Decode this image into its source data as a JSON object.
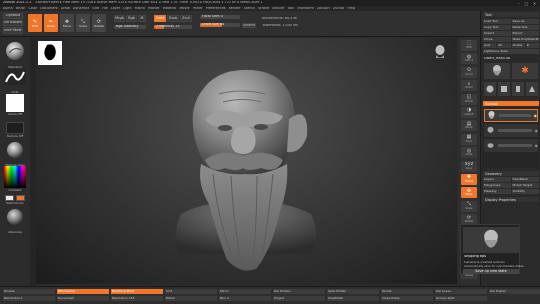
{
  "window": {
    "title": "ZBrush 2021.1.1",
    "subtitle": "ZBrushProject  ▸ Free Mem 19.7GB ▸ Active Mem 315 ▸ Scratch Disk 48 ▸ ZTime 1.31 Timer 0.003 ▸ PolyCount 1.721 KP ▸ MeshCount 1",
    "controls": [
      "–",
      "□",
      "✕"
    ]
  },
  "menubar": [
    "Alpha",
    "Brush",
    "Color",
    "Document",
    "Draw",
    "Dynamics",
    "Edit",
    "File",
    "Layer",
    "Light",
    "Macro",
    "Marker",
    "Material",
    "Movie",
    "Picker",
    "Preferences",
    "Render",
    "Stencil",
    "Stroke",
    "Texture",
    "Tool",
    "Transform",
    "Zplugin",
    "Zscript",
    "Help"
  ],
  "topshelf": {
    "lightbox": "LightBox",
    "live_boolean": "Live Boolean",
    "edit": "Edit",
    "draw": "Draw",
    "move": "Move",
    "scale": "Scale",
    "rotate": "Rotate",
    "mrgb": "Mrgb",
    "rgb": "Rgb",
    "m": "M",
    "zadd": "Zadd",
    "zsub": "Zsub",
    "zcut": "Zcut",
    "rgb_intensity": "Rgb Intensity",
    "z_intensity": "Z Intensity 25",
    "focal_shift": "Focal Shift 0",
    "draw_size": "Draw Size 64",
    "dynamic": "Dynamic",
    "active_points": "ActivePoints: 60,536",
    "total_points": "TotalPoints: 1.000 Mil",
    "quick_sketch": "Quick Sketch",
    "z_intensity_value": 0.25,
    "draw_size_value": 0.55
  },
  "leftshelf": [
    {
      "name": "brush",
      "label": "Standard"
    },
    {
      "name": "stroke",
      "label": "Dots"
    },
    {
      "name": "alpha",
      "label": "Alpha Off"
    },
    {
      "name": "texture",
      "label": "Texture Off"
    },
    {
      "name": "material",
      "label": "MatCap Gray"
    },
    {
      "name": "gradient",
      "label": "Gradient"
    },
    {
      "name": "switchcolor",
      "label": "SwitchColor"
    },
    {
      "name": "alternate",
      "label": "Alternate"
    }
  ],
  "rightstrip": [
    {
      "icon": "⬚",
      "label": "BPR"
    },
    {
      "icon": "◍",
      "label": "SPix 3"
    },
    {
      "icon": "⊙",
      "label": "Scroll"
    },
    {
      "icon": "⌕",
      "label": "Zoom"
    },
    {
      "icon": "◱",
      "label": "Actual"
    },
    {
      "icon": "◑",
      "label": "AAHalf"
    },
    {
      "icon": "▤",
      "label": "Persp"
    },
    {
      "icon": "▦",
      "label": "Floor"
    },
    {
      "icon": "◎",
      "label": "Local"
    },
    {
      "icon": "xyz",
      "label": "Gxyz"
    },
    {
      "icon": "✥",
      "label": "Frame"
    },
    {
      "icon": "✣",
      "label": "Move"
    },
    {
      "icon": "⤡",
      "label": "Scale"
    },
    {
      "icon": "⟳",
      "label": "Rotate"
    },
    {
      "icon": "▥",
      "label": "PolyF"
    },
    {
      "icon": "◫",
      "label": "Transp"
    },
    {
      "icon": "◨",
      "label": "Solo"
    },
    {
      "icon": "▣",
      "label": "Xpose"
    }
  ],
  "rightpanel": {
    "header": "Tool",
    "buttons": [
      [
        "Load Tool",
        "Save As"
      ],
      [
        "Copy Tool",
        "Paste Tool"
      ],
      [
        "Import",
        "Export"
      ],
      [
        "Clone",
        "Make PolyMesh3D"
      ],
      [
        "GoZ",
        "All",
        "Visible",
        "R"
      ],
      [
        "Lightbox ▸ Tools"
      ]
    ],
    "tool_name": "Dwarf_Head.48",
    "subtool": "Subtool",
    "geometry": "Geometry",
    "layers": "Layers",
    "fibermesh": "FiberMesh",
    "polygroups": "Polygroups",
    "morph_target": "Morph Target",
    "masking": "Masking",
    "visibility": "Visibility",
    "display_properties": "Display Properties"
  },
  "popup": {
    "title": "Shipping tips",
    "body": "Subsample smallest subtools",
    "body2": "Automatically save for intermediate states",
    "button": "Save up new state"
  },
  "bottombar": [
    "Double",
    "ZRemesher",
    "Backface Mask",
    "Smt",
    "Mirror",
    "Del Hidden",
    "Split Hidden",
    "Divide",
    "Del Lower",
    "Del Higher",
    "Reconstruct",
    "Dynamesh",
    "Resolution 128",
    "Polish",
    "Blur 2",
    "Project",
    "ClayPolish",
    "Close Holes",
    "Groups Split"
  ]
}
